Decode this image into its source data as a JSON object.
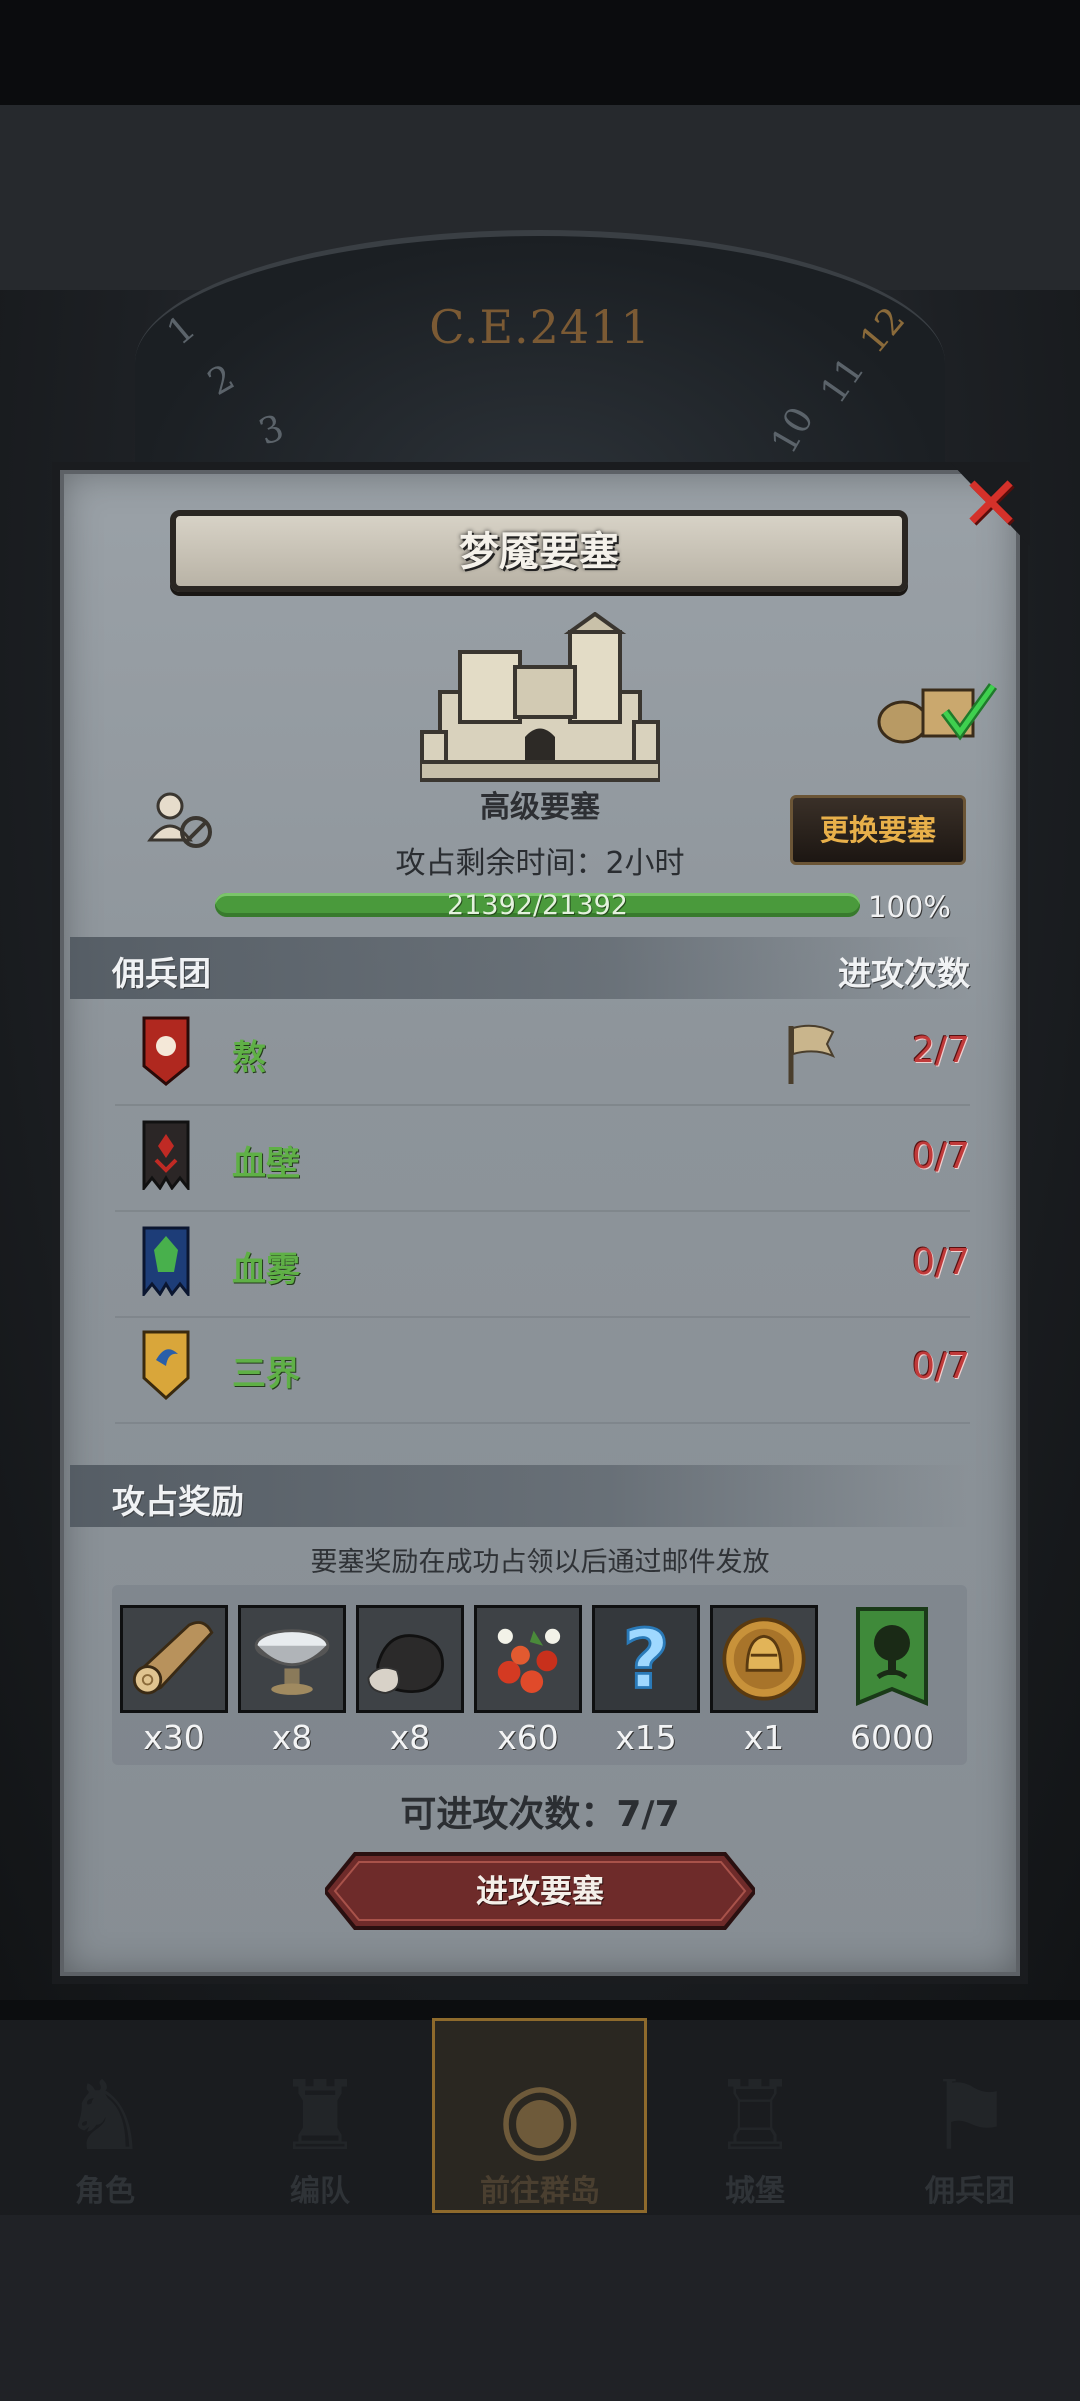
{
  "background": {
    "year": "C.E.2411",
    "dial_numbers": [
      "1",
      "2",
      "3",
      "10",
      "11",
      "12"
    ]
  },
  "dialog": {
    "title": "梦魇要塞",
    "fortress_grade": "高级要塞",
    "time_left": "攻占剩余时间：2小时",
    "progress_text": "21392/21392",
    "progress_percent": "100%",
    "progress_fraction": 1.0,
    "change_button": "更换要塞",
    "mercenary_header": "佣兵团",
    "attacks_header": "进攻次数",
    "rows": [
      {
        "name": "熬",
        "count": "2/7",
        "banner": "red-sun-banner-icon",
        "flag": true
      },
      {
        "name": "血壁",
        "count": "0/7",
        "banner": "dark-red-banner-icon",
        "flag": false
      },
      {
        "name": "血雾",
        "count": "0/7",
        "banner": "green-blue-banner-icon",
        "flag": false
      },
      {
        "name": "三界",
        "count": "0/7",
        "banner": "gold-shield-banner-icon",
        "flag": false
      }
    ],
    "reward_header": "攻占奖励",
    "reward_note": "要塞奖励在成功占领以后通过邮件发放",
    "rewards": [
      {
        "icon": "wood-log-icon",
        "qty": "x30"
      },
      {
        "icon": "silver-bowl-icon",
        "qty": "x8"
      },
      {
        "icon": "ore-stone-icon",
        "qty": "x8"
      },
      {
        "icon": "red-berries-icon",
        "qty": "x60"
      },
      {
        "icon": "mystery-question-icon",
        "qty": "x15"
      },
      {
        "icon": "golden-helmet-medal-icon",
        "qty": "x1"
      },
      {
        "icon": "green-tree-banner-icon",
        "qty": "6000"
      }
    ],
    "attack_count": "可进攻次数：7/7",
    "attack_button": "进攻要塞"
  },
  "nav": {
    "items": [
      {
        "label": "角色"
      },
      {
        "label": "编队"
      },
      {
        "label": "前往群岛"
      },
      {
        "label": "城堡"
      },
      {
        "label": "佣兵团"
      }
    ]
  },
  "colors": {
    "accent_gold": "#e8b04a",
    "merc_name_green": "#5fb046",
    "count_red": "#c03a3a",
    "progress_green": "#4a9a3c"
  }
}
